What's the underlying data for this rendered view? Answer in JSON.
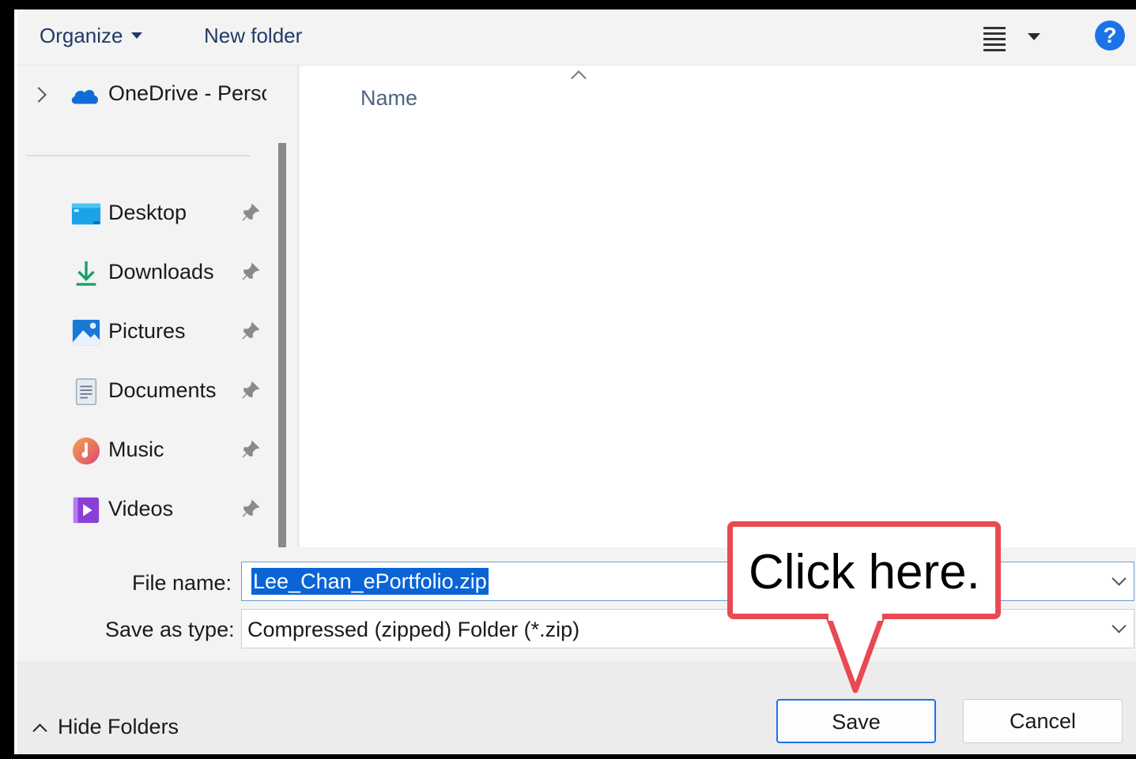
{
  "toolbar": {
    "organize_label": "Organize",
    "new_folder_label": "New folder",
    "view_icon": "list-view-icon",
    "help_label": "?"
  },
  "nav": {
    "onedrive": {
      "label": "OneDrive - Perso",
      "icon": "onedrive-cloud-icon"
    },
    "items": [
      {
        "label": "Desktop",
        "icon": "desktop-icon"
      },
      {
        "label": "Downloads",
        "icon": "downloads-icon"
      },
      {
        "label": "Pictures",
        "icon": "pictures-icon"
      },
      {
        "label": "Documents",
        "icon": "documents-icon"
      },
      {
        "label": "Music",
        "icon": "music-icon"
      },
      {
        "label": "Videos",
        "icon": "videos-icon"
      }
    ]
  },
  "content": {
    "column_name": "Name"
  },
  "form": {
    "file_name_label": "File name:",
    "file_name_value": "Lee_Chan_ePortfolio.zip",
    "save_type_label": "Save as type:",
    "save_type_value": "Compressed (zipped) Folder (*.zip)"
  },
  "footer": {
    "hide_folders_label": "Hide Folders",
    "save_label": "Save",
    "cancel_label": "Cancel"
  },
  "callout": {
    "text": "Click here."
  },
  "colors": {
    "accent": "#1a73e8",
    "selection": "#0a64d6",
    "callout_border": "#e84a51"
  }
}
